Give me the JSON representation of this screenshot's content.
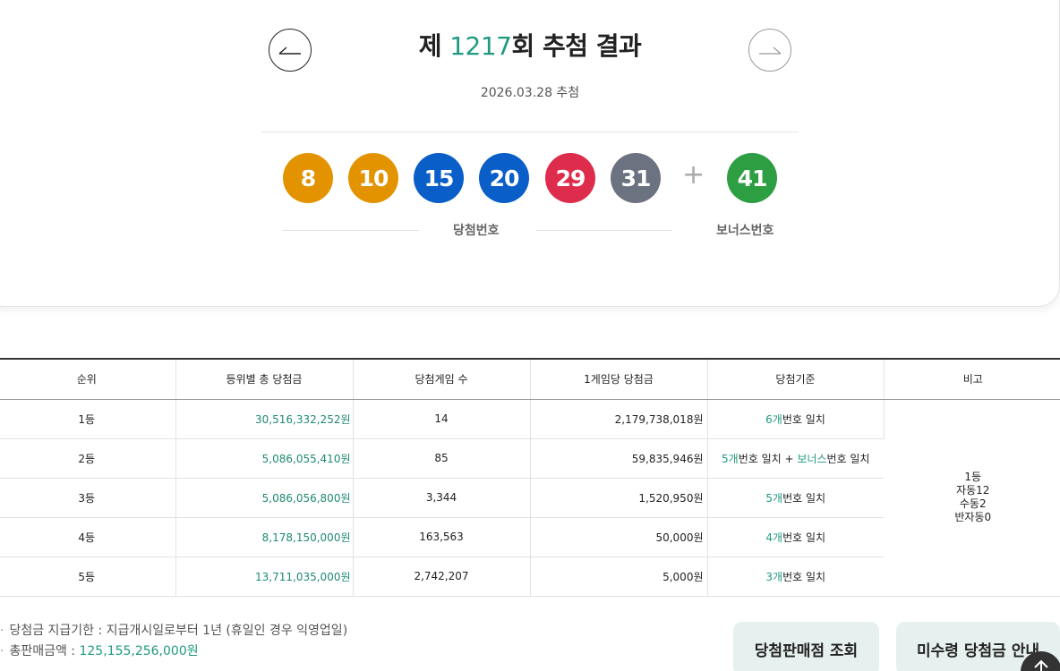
{
  "header": {
    "title_prefix": "제 ",
    "round": "1217",
    "title_suffix": "회 추첨 결과",
    "date": "2026.03.28 추첨"
  },
  "balls": [
    {
      "number": "8",
      "color": "#e39300"
    },
    {
      "number": "10",
      "color": "#e39300"
    },
    {
      "number": "15",
      "color": "#0a5ec7"
    },
    {
      "number": "20",
      "color": "#0a5ec7"
    },
    {
      "number": "29",
      "color": "#de2d4c"
    },
    {
      "number": "31",
      "color": "#6b7280"
    }
  ],
  "plus": "+",
  "bonus": {
    "number": "41",
    "color": "#2e9e43"
  },
  "labels": {
    "winning": "당첨번호",
    "bonus": "보너스번호"
  },
  "table": {
    "headers": [
      "순위",
      "등위별 총 당첨금",
      "당첨게임 수",
      "1게임당 당첨금",
      "당첨기준",
      "비고"
    ],
    "rows": [
      {
        "rank": "1등",
        "total": "30,516,332,252원",
        "games": "14",
        "per_game": "2,179,738,018원",
        "crit_num": "6개",
        "crit_rest": "번호 일치"
      },
      {
        "rank": "2등",
        "total": "5,086,055,410원",
        "games": "85",
        "per_game": "59,835,946원",
        "crit_num": "5개",
        "crit_mid": "번호 일치 + ",
        "crit_bonus": "보너스",
        "crit_rest": "번호 일치"
      },
      {
        "rank": "3등",
        "total": "5,086,056,800원",
        "games": "3,344",
        "per_game": "1,520,950원",
        "crit_num": "5개",
        "crit_rest": "번호 일치"
      },
      {
        "rank": "4등",
        "total": "8,178,150,000원",
        "games": "163,563",
        "per_game": "50,000원",
        "crit_num": "4개",
        "crit_rest": "번호 일치"
      },
      {
        "rank": "5등",
        "total": "13,711,035,000원",
        "games": "2,742,207",
        "per_game": "5,000원",
        "crit_num": "3개",
        "crit_rest": "번호 일치"
      }
    ],
    "remark": [
      "1등",
      "자동12",
      "수동2",
      "반자동0"
    ]
  },
  "notes": {
    "bullet": "·",
    "deadline": "당첨금 지급기한 : 지급개시일로부터 1년 (휴일인 경우 익영업일)",
    "sales_label": "총판매금액 : ",
    "sales_amount": "125,155,256,000원"
  },
  "buttons": {
    "store": "당첨판매점 조회",
    "unclaimed": "미수령 당첨금 안내"
  }
}
